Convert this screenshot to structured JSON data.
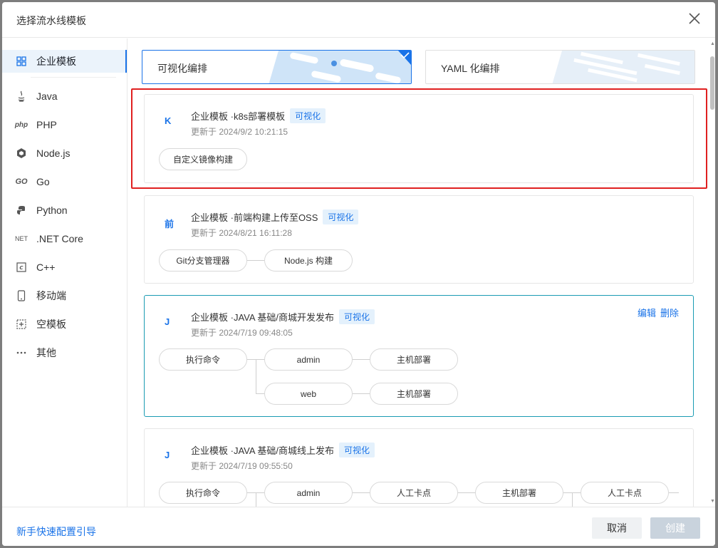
{
  "dialog": {
    "title": "选择流水线模板"
  },
  "sidebar": {
    "items": [
      {
        "label": "企业模板",
        "icon": "grid-icon"
      },
      {
        "label": "Java",
        "icon": "java-icon"
      },
      {
        "label": "PHP",
        "icon": "php-icon",
        "glyph": "php"
      },
      {
        "label": "Node.js",
        "icon": "nodejs-icon"
      },
      {
        "label": "Go",
        "icon": "go-icon",
        "glyph": "GO"
      },
      {
        "label": "Python",
        "icon": "python-icon"
      },
      {
        "label": ".NET Core",
        "icon": "dotnet-icon",
        "glyph": "NET"
      },
      {
        "label": "C++",
        "icon": "cpp-icon"
      },
      {
        "label": "移动端",
        "icon": "mobile-icon"
      },
      {
        "label": "空模板",
        "icon": "empty-template-icon"
      },
      {
        "label": "其他",
        "icon": "more-icon"
      }
    ]
  },
  "modes": {
    "visual": "可视化编排",
    "yaml": "YAML 化编排"
  },
  "templates": [
    {
      "avatar": "K",
      "title": "企业模板 ·k8s部署模板",
      "tag": "可视化",
      "updated": "更新于 2024/9/2 10:21:15",
      "steps": [
        "自定义镜像构建"
      ]
    },
    {
      "avatar": "前",
      "title": "企业模板 ·前端构建上传至OSS",
      "tag": "可视化",
      "updated": "更新于 2024/8/21 16:11:28",
      "steps": [
        "Git分支管理器",
        "Node.js 构建"
      ]
    },
    {
      "avatar": "J",
      "title": "企业模板 ·JAVA 基础/商城开发发布",
      "tag": "可视化",
      "updated": "更新于 2024/7/19 09:48:05",
      "actions": {
        "edit": "编辑",
        "delete": "删除"
      },
      "steps": [
        "执行命令",
        "admin",
        "主机部署",
        "web",
        "主机部署"
      ]
    },
    {
      "avatar": "J",
      "title": "企业模板 ·JAVA 基础/商城线上发布",
      "tag": "可视化",
      "updated": "更新于 2024/7/19 09:55:50",
      "steps": [
        "执行命令",
        "admin",
        "人工卡点",
        "主机部署",
        "人工卡点"
      ]
    }
  ],
  "footer": {
    "guide": "新手快速配置引导",
    "cancel": "取消",
    "create": "创建"
  },
  "colors": {
    "accent": "#1a73e8",
    "highlight": "#e02020",
    "hover_border": "#1a9bb3"
  }
}
